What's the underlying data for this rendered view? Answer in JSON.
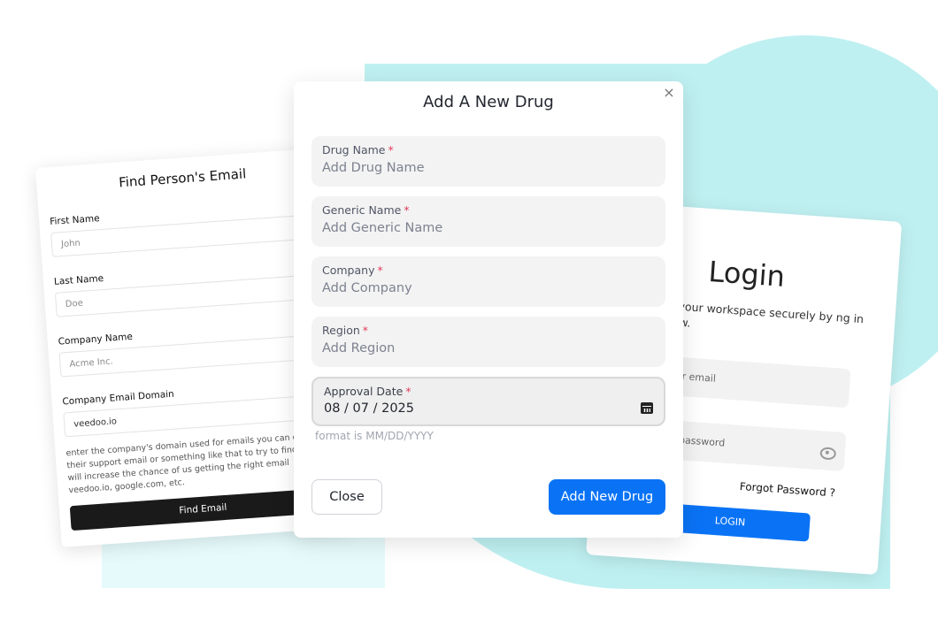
{
  "left_card": {
    "title": "Find Person's Email",
    "first_name_label": "First Name",
    "first_name_placeholder": "John",
    "last_name_label": "Last Name",
    "last_name_placeholder": "Doe",
    "company_name_label": "Company Name",
    "company_name_placeholder": "Acme Inc.",
    "domain_label": "Company Email Domain",
    "domain_value": "veedoo.io",
    "help_text": "enter the company's domain used for emails you can check their support email or something like that to try to find it. this will increase the chance of us getting the right email veedoo.io, google.com, etc.",
    "submit_label": "Find Email"
  },
  "modal": {
    "title": "Add A New Drug",
    "close_icon": "×",
    "fields": [
      {
        "label": "Drug Name",
        "required": "*",
        "placeholder": "Add Drug Name"
      },
      {
        "label": "Generic Name",
        "required": "*",
        "placeholder": "Add Generic Name"
      },
      {
        "label": "Company",
        "required": "*",
        "placeholder": "Add Company"
      },
      {
        "label": "Region",
        "required": "*",
        "placeholder": "Add Region"
      }
    ],
    "approval_date": {
      "label": "Approval Date",
      "required": "*",
      "value": "08 / 07 / 2025"
    },
    "date_helper": "format is MM/DD/YYYY",
    "close_label": "Close",
    "submit_label": "Add New Drug"
  },
  "right_card": {
    "title": "Login",
    "subtitle": "ess your workspace securely by ng in below.",
    "email_label_fragment": "*",
    "email_placeholder": "your email",
    "password_label_fragment": "ord",
    "password_required": "*",
    "password_placeholder": "our password",
    "forgot_label": "Forgot Password ?",
    "login_label": "LOGIN"
  },
  "colors": {
    "primary": "#0a73f5",
    "required": "#e23c5a",
    "background_shape": "#bff0f1"
  }
}
